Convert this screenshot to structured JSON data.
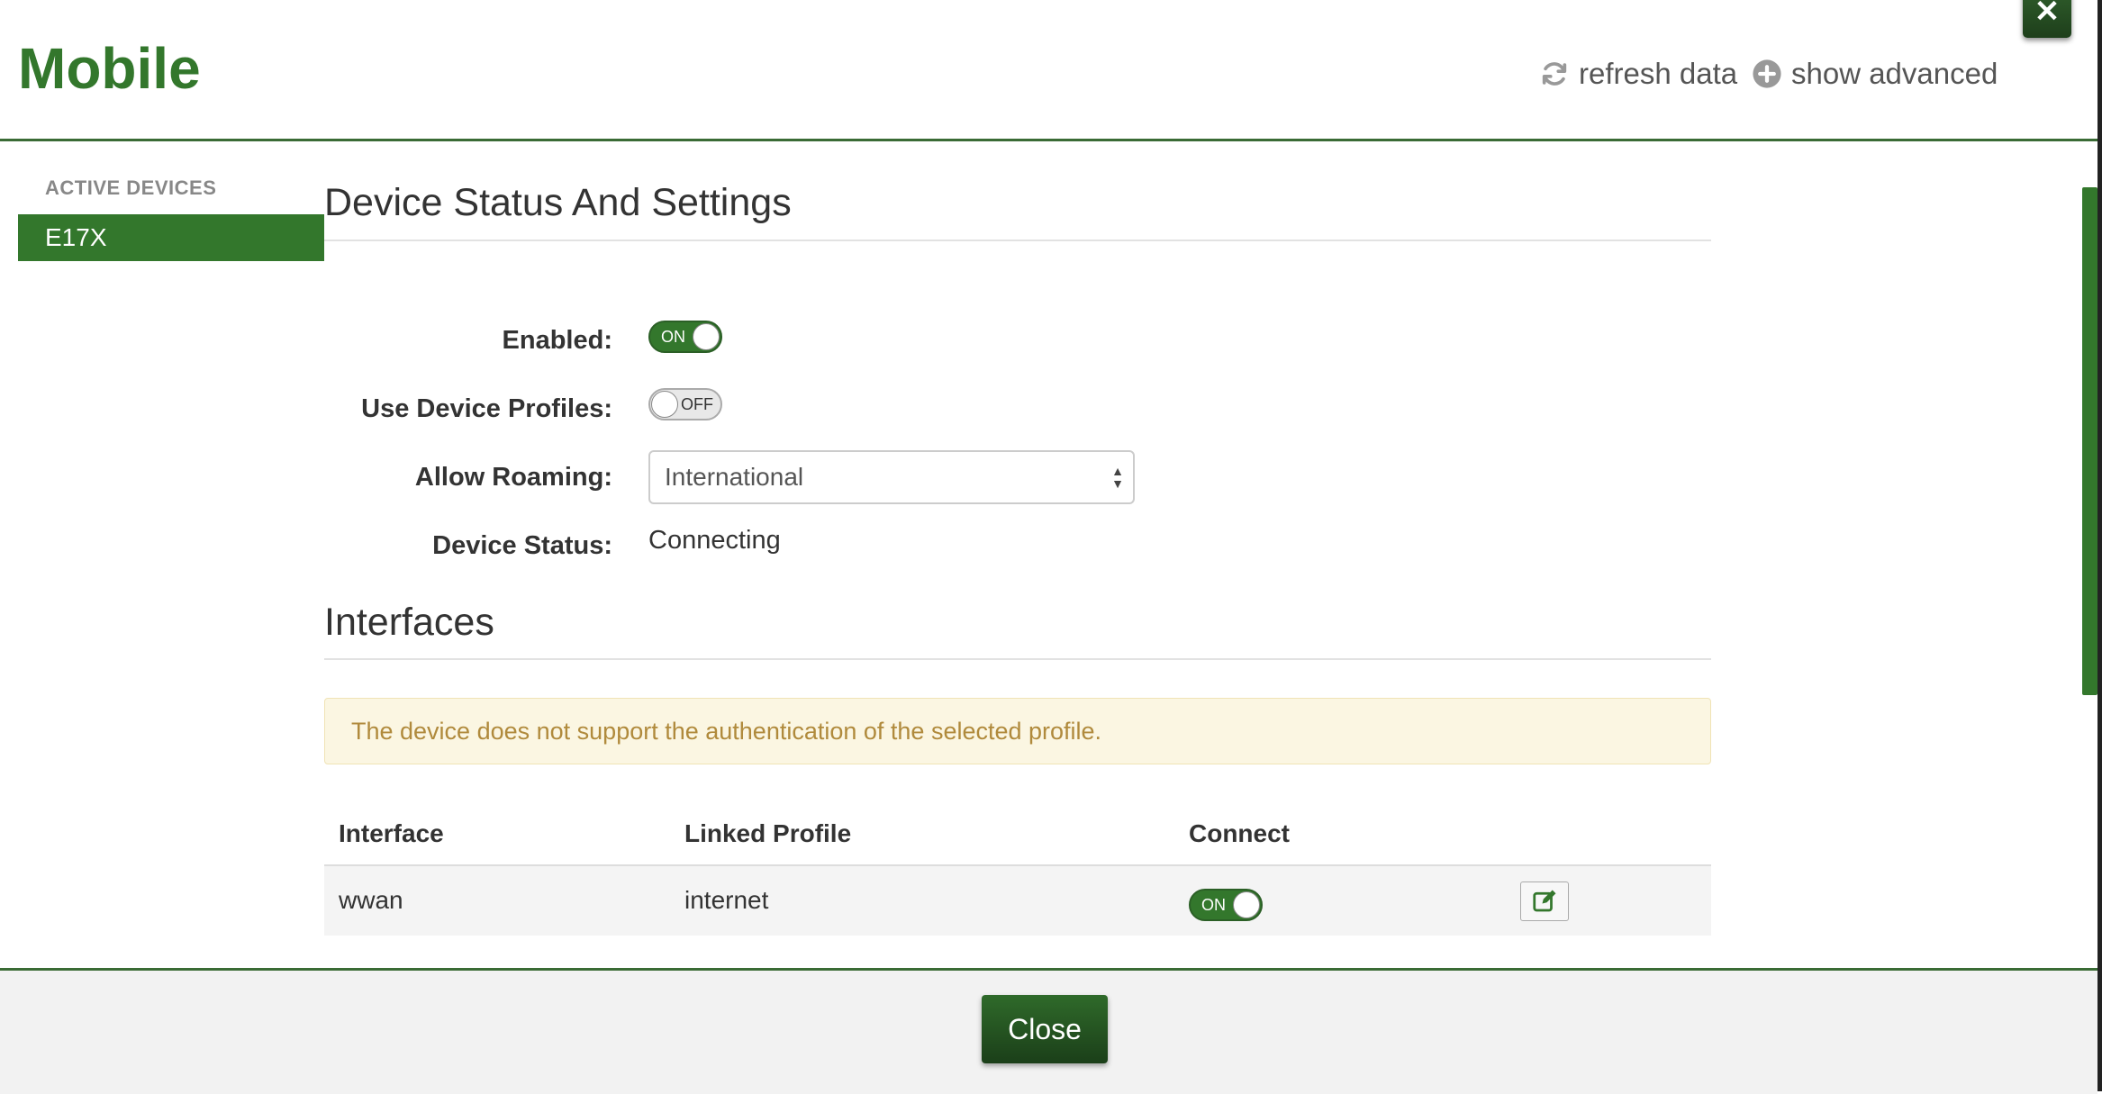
{
  "header": {
    "title": "Mobile",
    "refresh_label": "refresh data",
    "advanced_label": "show advanced",
    "close_x": "✕"
  },
  "sidebar": {
    "heading": "ACTIVE DEVICES",
    "items": [
      {
        "label": "E17X",
        "selected": true
      }
    ]
  },
  "settings": {
    "heading": "Device Status And Settings",
    "enabled_label": "Enabled:",
    "enabled_state": "ON",
    "profiles_label": "Use Device Profiles:",
    "profiles_state": "OFF",
    "roaming_label": "Allow Roaming:",
    "roaming_value": "International",
    "status_label": "Device Status:",
    "status_value": "Connecting"
  },
  "interfaces": {
    "heading": "Interfaces",
    "alert": "The device does not support the authentication of the selected profile.",
    "columns": [
      "Interface",
      "Linked Profile",
      "Connect"
    ],
    "rows": [
      {
        "interface": "wwan",
        "profile": "internet",
        "connect": "ON"
      }
    ]
  },
  "footer": {
    "close_label": "Close"
  },
  "colors": {
    "accent": "#33772c",
    "alert_bg": "#fbf6e2",
    "alert_text": "#b08a3c"
  }
}
